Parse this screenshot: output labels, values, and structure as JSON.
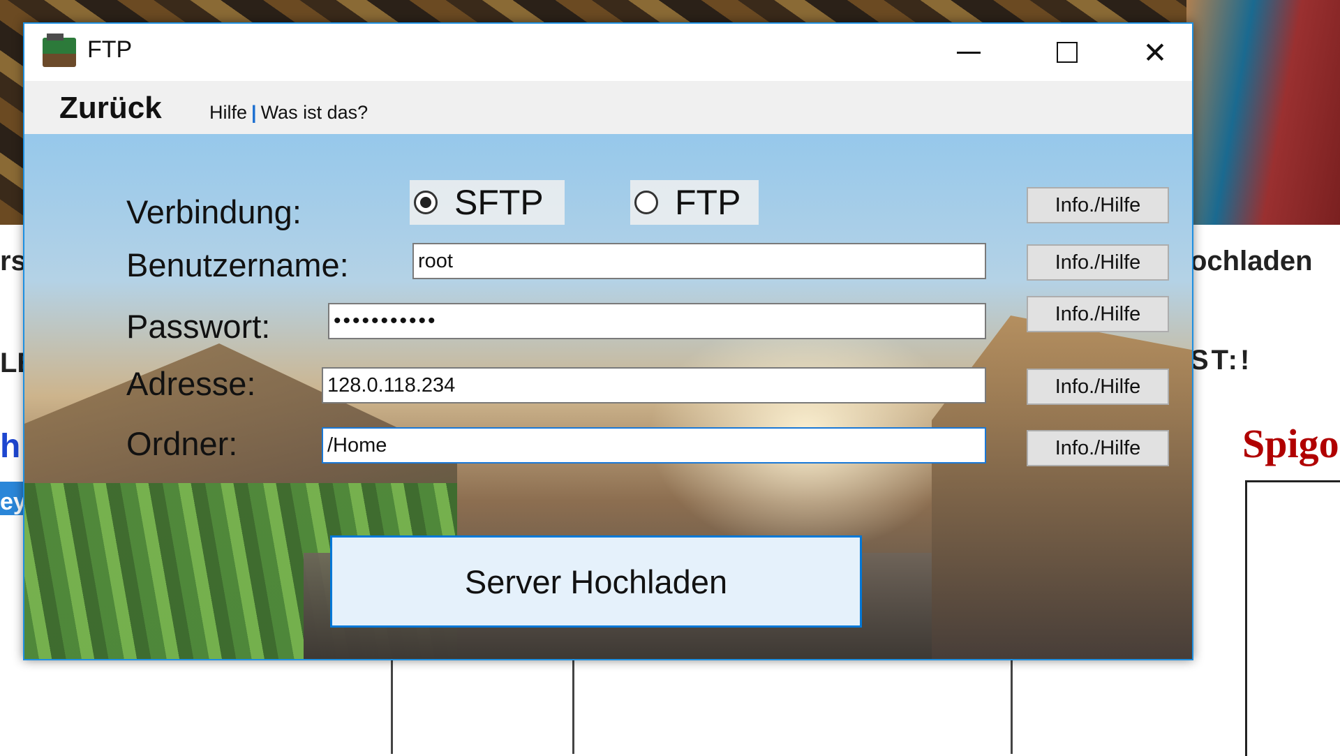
{
  "background": {
    "fragments": {
      "left_mid": "rs",
      "left_caps": "LE",
      "left_mark": "h",
      "left_blue": "ey",
      "right_hochladen": "ochladen",
      "right_list": "ST:!",
      "right_spigot": "Spigo"
    }
  },
  "window": {
    "title": "FTP",
    "icon": "minecraft-grass-block-icon",
    "controls": {
      "minimize": "minimize-icon",
      "maximize": "maximize-icon",
      "close": "✕"
    }
  },
  "menubar": {
    "back": "Zurück",
    "help": "Hilfe",
    "separator": "|",
    "what_is": "Was ist das?"
  },
  "form": {
    "connection_label": "Verbindung:",
    "protocol_options": [
      {
        "label": "SFTP",
        "checked": true
      },
      {
        "label": "FTP",
        "checked": false
      }
    ],
    "username_label": "Benutzername:",
    "username_value": "root",
    "password_label": "Passwort:",
    "password_value": "•••••••••••",
    "address_label": "Adresse:",
    "address_value": "128.0.118.234",
    "folder_label": "Ordner:",
    "folder_value": "/Home",
    "info_button": "Info./Hilfe",
    "upload_button": "Server Hochladen"
  },
  "colors": {
    "window_border": "#1e8fe0",
    "button_primary_border": "#0078d7",
    "button_primary_bg": "#e5f1fb",
    "help_separator": "#1c6fd1"
  }
}
